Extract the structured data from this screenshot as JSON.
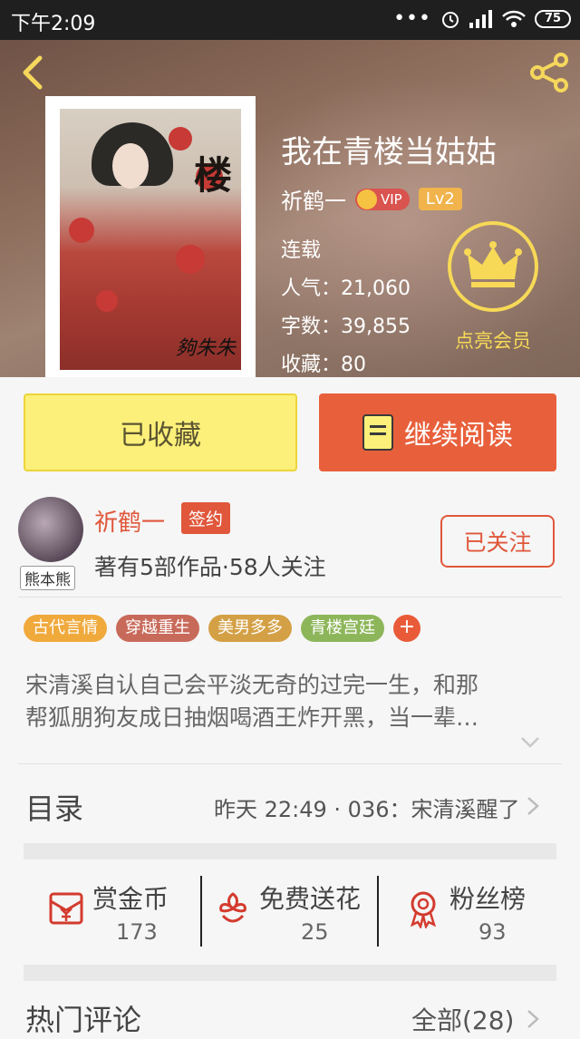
{
  "status_bar": {
    "time": "下午2:09",
    "battery": "75",
    "icons": [
      "more-dots-icon",
      "alarm-icon",
      "signal-icon",
      "wifi-icon",
      "battery-icon"
    ]
  },
  "header": {
    "back_icon": "back-chevron-icon",
    "share_icon": "share-icon"
  },
  "book": {
    "cover_title": "楼",
    "cover_signature": "夠朱朱",
    "title": "我在青楼当姑姑",
    "author": "祈鹤一",
    "vip": "VIP",
    "level": "Lv2",
    "status": "连载",
    "popularity": "人气：21,060",
    "word_count": "字数：39,855",
    "favorites": "收藏：80"
  },
  "member": {
    "label": "点亮会员",
    "icon": "crown-icon"
  },
  "buttons": {
    "favorited": "已收藏",
    "continue_reading": "继续阅读"
  },
  "author_card": {
    "name": "祈鹤一",
    "signed": "签约",
    "avatar_tag": "熊本熊",
    "info": "著有5部作品·58人关注",
    "follow": "已关注"
  },
  "tags": [
    {
      "label": "古代言情",
      "color": "#f0a93b"
    },
    {
      "label": "穿越重生",
      "color": "#c86a5a"
    },
    {
      "label": "美男多多",
      "color": "#d4a046"
    },
    {
      "label": "青楼宫廷",
      "color": "#8db65a"
    }
  ],
  "tag_add": "+",
  "synopsis": {
    "line1": "宋清溪自认自己会平淡无奇的过完一生，和那",
    "line2": "帮狐朋狗友成日抽烟喝酒王炸开黑，当一辈…"
  },
  "toc": {
    "label": "目录",
    "latest": "昨天 22:49 · 036：宋清溪醒了"
  },
  "actions": [
    {
      "label": "赏金币",
      "count": "173",
      "icon": "coin-envelope-icon"
    },
    {
      "label": "免费送花",
      "count": "25",
      "icon": "flower-icon"
    },
    {
      "label": "粉丝榜",
      "count": "93",
      "icon": "medal-icon"
    }
  ],
  "hot_comments": {
    "label": "热门评论",
    "all": "全部(28)"
  }
}
